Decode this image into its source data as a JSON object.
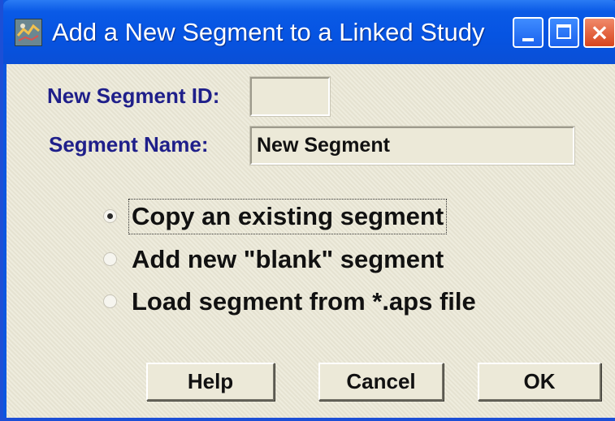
{
  "window": {
    "title": "Add a New Segment to a Linked Study",
    "icon": "app-icon",
    "controls": {
      "minimize": "minimize-icon",
      "maximize": "maximize-icon",
      "close": "×"
    },
    "accent": "#0a5ae6",
    "client_bg": "#ece9d8"
  },
  "form": {
    "segment_id_label": "New Segment ID:",
    "segment_id_value": "",
    "segment_name_label": "Segment Name:",
    "segment_name_value": "New Segment",
    "label_color": "#1f1f8a"
  },
  "options": [
    {
      "label": "Copy an existing segment",
      "selected": true
    },
    {
      "label": "Add new \"blank\" segment",
      "selected": false
    },
    {
      "label": "Load segment from *.aps file",
      "selected": false
    }
  ],
  "buttons": {
    "help": "Help",
    "cancel": "Cancel",
    "ok": "OK"
  }
}
